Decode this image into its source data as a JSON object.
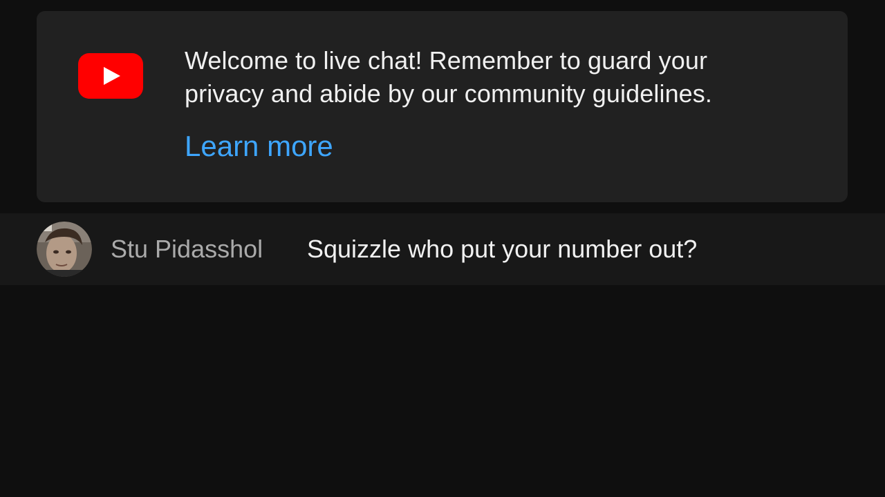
{
  "welcome": {
    "logo_icon": "youtube-logo-icon",
    "line1": "Welcome to live chat! Remember to guard your",
    "line2": "privacy and abide by our community guidelines.",
    "learn_more_label": "Learn more",
    "link_color": "#3ea6ff",
    "brand_color": "#ff0000"
  },
  "chat": {
    "messages": [
      {
        "avatar_icon": "user-avatar",
        "author": "Stu Pidasshol",
        "text": "Squizzle who put your number out?"
      }
    ]
  }
}
